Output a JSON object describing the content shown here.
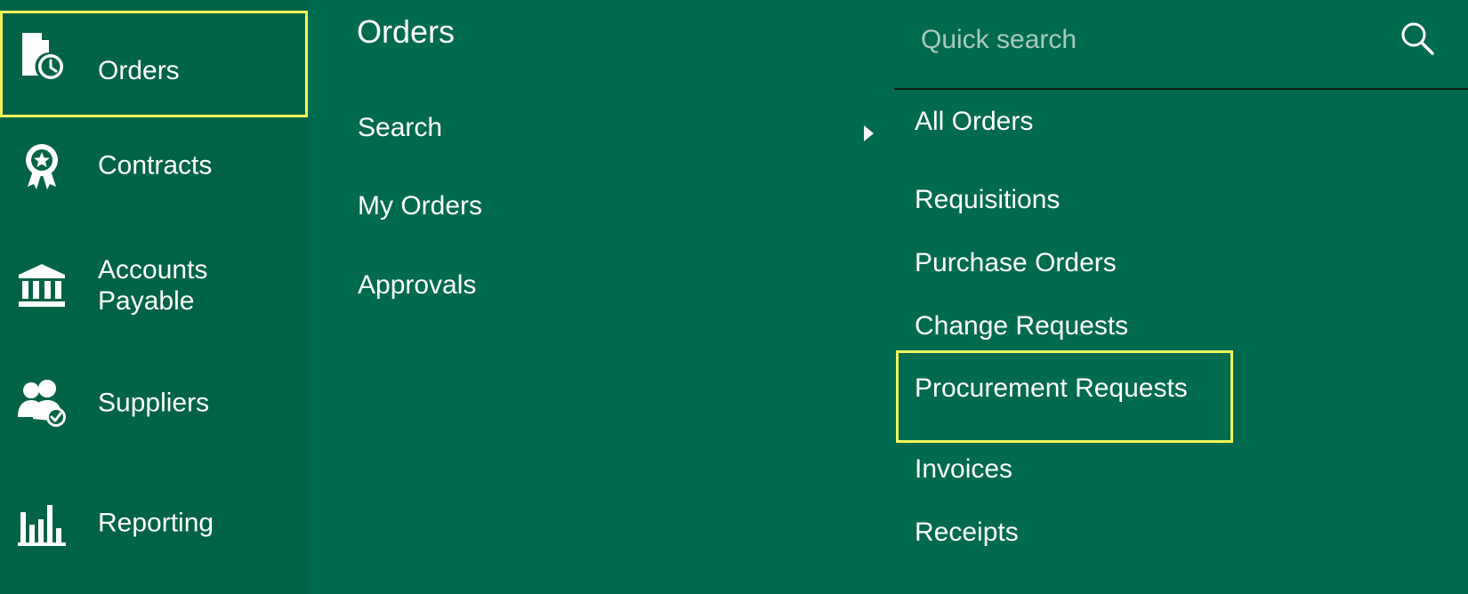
{
  "sidebar": {
    "items": [
      {
        "label": "Orders",
        "icon": "orders-clock-icon"
      },
      {
        "label": "Contracts",
        "icon": "award-badge-icon"
      },
      {
        "label": "Accounts Payable",
        "icon": "bank-icon"
      },
      {
        "label": "Suppliers",
        "icon": "users-check-icon"
      },
      {
        "label": "Reporting",
        "icon": "bar-chart-icon"
      }
    ]
  },
  "menu": {
    "title": "Orders",
    "links": [
      {
        "label": "Search"
      },
      {
        "label": "My Orders"
      },
      {
        "label": "Approvals"
      }
    ]
  },
  "search": {
    "placeholder": "Quick search",
    "icon": "search-icon"
  },
  "submenu": {
    "items": [
      {
        "label": "All Orders"
      },
      {
        "label": "Requisitions"
      },
      {
        "label": "Purchase Orders"
      },
      {
        "label": "Change Requests"
      },
      {
        "label": "Procurement Requests"
      },
      {
        "label": "Invoices"
      },
      {
        "label": "Receipts"
      }
    ]
  },
  "colors": {
    "background": "#006a4e",
    "sidebar": "#006346",
    "highlight": "#f1f55b",
    "text": "#ffffff"
  }
}
